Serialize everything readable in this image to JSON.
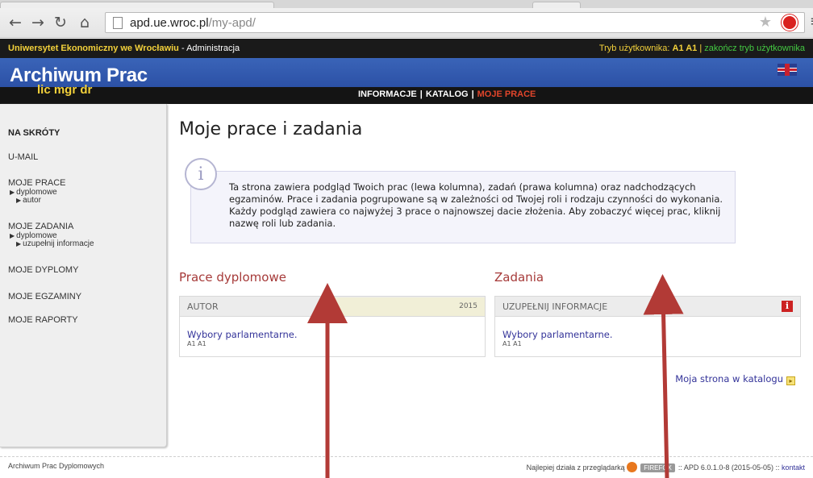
{
  "browser": {
    "url_host": "apd.ue.wroc.pl",
    "url_path": "/my-apd/",
    "icons": [
      "back-icon",
      "forward-icon",
      "reload-icon",
      "home-icon",
      "page-icon",
      "star-icon",
      "extension-icon",
      "menu-icon"
    ]
  },
  "topbar": {
    "university": "Uniwersytet Ekonomiczny we Wrocławiu",
    "admin": " - Administracja",
    "mode_label": "Tryb użytkownika: ",
    "mode_user": "A1 A1",
    "mode_sep": " | ",
    "mode_end": "zakończ tryb użytkownika"
  },
  "banner": {
    "title": "Archiwum Prac",
    "subtitle": "lic mgr dr"
  },
  "nav": {
    "items": [
      "INFORMACJE",
      "KATALOG",
      "MOJE PRACE"
    ],
    "active": "MOJE PRACE"
  },
  "sidebar": {
    "heading": "NA SKRÓTY",
    "umail": "U-MAIL",
    "moje_prace": "MOJE PRACE",
    "dyplomowe": "dyplomowe",
    "autor": "autor",
    "moje_zadania": "MOJE ZADANIA",
    "dyplomowe2": "dyplomowe",
    "uzupelnij": "uzupełnij informacje",
    "moje_dyplomy": "MOJE DYPLOMY",
    "moje_egzaminy": "MOJE EGZAMINY",
    "moje_raporty": "MOJE RAPORTY"
  },
  "main": {
    "title": "Moje prace i zadania",
    "info_icon": "i",
    "info_text": "Ta strona zawiera podgląd Twoich prac (lewa kolumna), zadań (prawa kolumna) oraz nadchodzących egzaminów. Prace i zadania pogrupowane są w zależności od Twojej roli i rodzaju czynności do wykonania. Każdy podgląd zawiera co najwyżej 3 prace o najnowszej dacie złożenia. Aby zobaczyć więcej prac, kliknij nazwę roli lub zadania."
  },
  "prace": {
    "title": "Prace dyplomowe",
    "header": "AUTOR",
    "year": "2015",
    "link": "Wybory parlamentarne.",
    "owner": "A1 A1"
  },
  "zadania": {
    "title": "Zadania",
    "header": "UZUPEŁNIJ INFORMACJE",
    "alert": "i",
    "link": "Wybory parlamentarne.",
    "owner": "A1 A1"
  },
  "catalog_link": "Moja strona w katalogu",
  "footer": {
    "left": "Archiwum Prac Dyplomowych",
    "best_with": "Najlepiej działa z przeglądarką",
    "badge": "FIREFOX",
    "version": ":: APD 6.0.1.0-8 (2015-05-05) :: ",
    "contact": "kontakt"
  },
  "colors": {
    "banner_blue": "#3a64b8",
    "topbar_black": "#1a1a1a",
    "accent_yellow": "#f3d13b",
    "active_nav": "#e0452b",
    "section_title": "#a63a39",
    "link": "#333399",
    "annotation_arrow": "#b23a36"
  }
}
